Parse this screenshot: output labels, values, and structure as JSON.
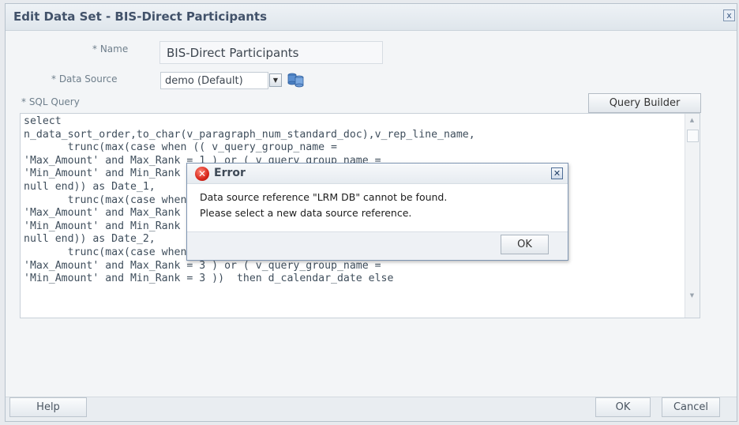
{
  "dialog": {
    "title": "Edit Data Set - BIS-Direct Participants",
    "close_glyph": "x",
    "fields": {
      "name_label": "* Name",
      "name_value": "BIS-Direct Participants",
      "datasource_label": "* Data Source",
      "datasource_value": "demo (Default)",
      "sql_label": "* SQL Query"
    },
    "query_builder_label": "Query Builder",
    "sql_query": "select\nn_data_sort_order,to_char(v_paragraph_num_standard_doc),v_rep_line_name,\n       trunc(max(case when (( v_query_group_name =\n'Max_Amount' and Max_Rank = 1 ) or ( v_query_group_name =\n'Min_Amount' and Min_Rank = 1 ))  then d_calendar_date else\nnull end)) as Date_1,\n       trunc(max(case when (( v_query_group_name =\n'Max_Amount' and Max_Rank = 2 ) or ( v_query_group_name =\n'Min_Amount' and Min_Rank = 2 ))  then d_calendar_date else\nnull end)) as Date_2,\n       trunc(max(case when (( v_query_group_name =\n'Max_Amount' and Max_Rank = 3 ) or ( v_query_group_name =\n'Min_Amount' and Min_Rank = 3 ))  then d_calendar_date else",
    "footer": {
      "help_label": "Help",
      "ok_label": "OK",
      "cancel_label": "Cancel"
    }
  },
  "error_dialog": {
    "title": "Error",
    "message_line1": "Data source reference \"LRM DB\" cannot be found.",
    "message_line2": "Please select a new data source reference.",
    "ok_label": "OK"
  },
  "icons": {
    "close": "close-icon",
    "error": "error-icon",
    "dropdown": "chevron-down-icon",
    "datasource": "database-icon"
  },
  "colors": {
    "title_text": "#42526a",
    "error_red": "#d8261a",
    "border_blue": "#7e95b2"
  }
}
